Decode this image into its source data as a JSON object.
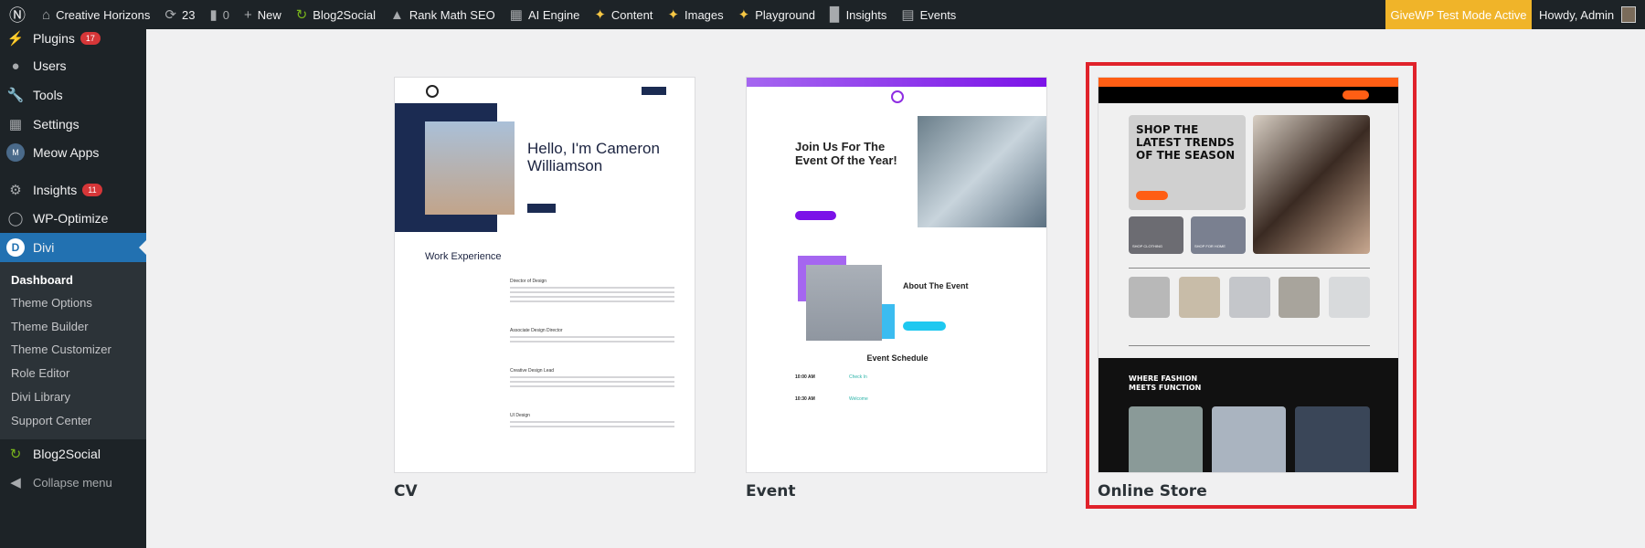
{
  "adminbar": {
    "site_name": "Creative Horizons",
    "updates_count": "23",
    "comments_count": "0",
    "new_label": "New",
    "items": [
      "Blog2Social",
      "Rank Math SEO",
      "AI Engine",
      "Content",
      "Images",
      "Playground",
      "Insights",
      "Events"
    ],
    "givewp_notice": "GiveWP Test Mode Active",
    "howdy": "Howdy, Admin"
  },
  "sidebar": {
    "items": [
      {
        "label": "Plugins",
        "badge": "17"
      },
      {
        "label": "Users"
      },
      {
        "label": "Tools"
      },
      {
        "label": "Settings"
      },
      {
        "label": "Meow Apps"
      },
      {
        "label": "Insights",
        "badge": "11"
      },
      {
        "label": "WP-Optimize"
      },
      {
        "label": "Divi"
      },
      {
        "label": "Blog2Social"
      },
      {
        "label": "Collapse menu"
      }
    ],
    "submenu": [
      "Dashboard",
      "Theme Options",
      "Theme Builder",
      "Theme Customizer",
      "Role Editor",
      "Divi Library",
      "Support Center"
    ]
  },
  "layouts": [
    {
      "name": "CV",
      "heading": "Hello, I'm Cameron Williamson",
      "section": "Work Experience",
      "jobs": [
        "Director of Design",
        "Associate Design Director",
        "Creative Design Lead",
        "UI Design"
      ]
    },
    {
      "name": "Event",
      "heading": "Join Us For The Event Of the Year!",
      "about": "About The Event",
      "schedule": "Event Schedule",
      "times": [
        "10:00 AM",
        "10:30 AM"
      ],
      "sessions": [
        "Check In",
        "Welcome"
      ]
    },
    {
      "name": "Online Store",
      "heading": "SHOP THE LATEST TRENDS OF THE SEASON",
      "tiles": [
        "SHOP CLOTHING",
        "SHOP FOR HOME"
      ],
      "section": "WHERE FASHION MEETS FUNCTION"
    }
  ],
  "colors": {
    "accent": "#2271b1",
    "selected_border": "#e0222b",
    "givewp": "#f0b429"
  }
}
